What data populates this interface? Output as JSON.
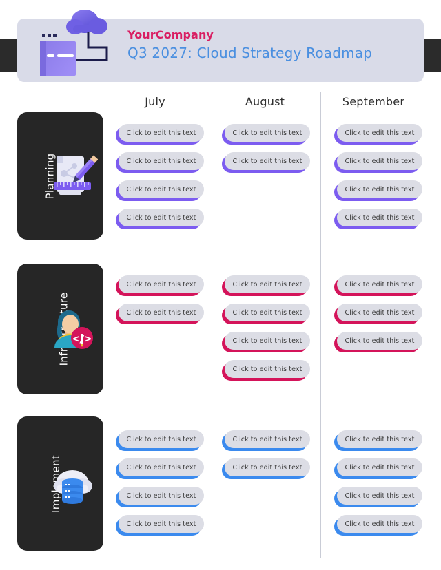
{
  "header": {
    "company_name": "YourCompany",
    "title": "Q3 2027: Cloud Strategy Roadmap",
    "art_icon": "cloud-folder-icon",
    "band_color": "#2b2b2b",
    "card_color": "#d9dbe8",
    "company_color": "#d91e62",
    "title_color": "#4a8fe0"
  },
  "columns": [
    {
      "label": "July"
    },
    {
      "label": "August"
    },
    {
      "label": "September"
    }
  ],
  "rows": [
    {
      "label": "Planning",
      "icon": "document-pencil-ruler-icon",
      "accent": "#7c5cf0",
      "cells": [
        {
          "column": "July",
          "cards": [
            {
              "text": "Click to edit this text"
            },
            {
              "text": "Click to edit this text"
            },
            {
              "text": "Click to edit this text"
            },
            {
              "text": "Click to edit this text"
            }
          ]
        },
        {
          "column": "August",
          "cards": [
            {
              "text": "Click to edit this text"
            },
            {
              "text": "Click to edit this text"
            }
          ]
        },
        {
          "column": "September",
          "cards": [
            {
              "text": "Click to edit this text"
            },
            {
              "text": "Click to edit this text"
            },
            {
              "text": "Click to edit this text"
            },
            {
              "text": "Click to edit this text"
            }
          ]
        }
      ]
    },
    {
      "label": "Infrastructure",
      "icon": "developer-code-badge-icon",
      "accent": "#d4145a",
      "cells": [
        {
          "column": "July",
          "cards": [
            {
              "text": "Click to edit this text"
            },
            {
              "text": "Click to edit this text"
            }
          ]
        },
        {
          "column": "August",
          "cards": [
            {
              "text": "Click to edit this text"
            },
            {
              "text": "Click to edit this text"
            },
            {
              "text": "Click to edit this text"
            },
            {
              "text": "Click to edit this text"
            }
          ]
        },
        {
          "column": "September",
          "cards": [
            {
              "text": "Click to edit this text"
            },
            {
              "text": "Click to edit this text"
            },
            {
              "text": "Click to edit this text"
            }
          ]
        }
      ]
    },
    {
      "label": "Implement",
      "icon": "cloud-database-icon",
      "accent": "#3b8aee",
      "cells": [
        {
          "column": "July",
          "cards": [
            {
              "text": "Click to edit this text"
            },
            {
              "text": "Click to edit this text"
            },
            {
              "text": "Click to edit this text"
            },
            {
              "text": "Click to edit this text"
            }
          ]
        },
        {
          "column": "August",
          "cards": [
            {
              "text": "Click to edit this text"
            },
            {
              "text": "Click to edit this text"
            }
          ]
        },
        {
          "column": "September",
          "cards": [
            {
              "text": "Click to edit this text"
            },
            {
              "text": "Click to edit this text"
            },
            {
              "text": "Click to edit this text"
            },
            {
              "text": "Click to edit this text"
            }
          ]
        }
      ]
    }
  ]
}
